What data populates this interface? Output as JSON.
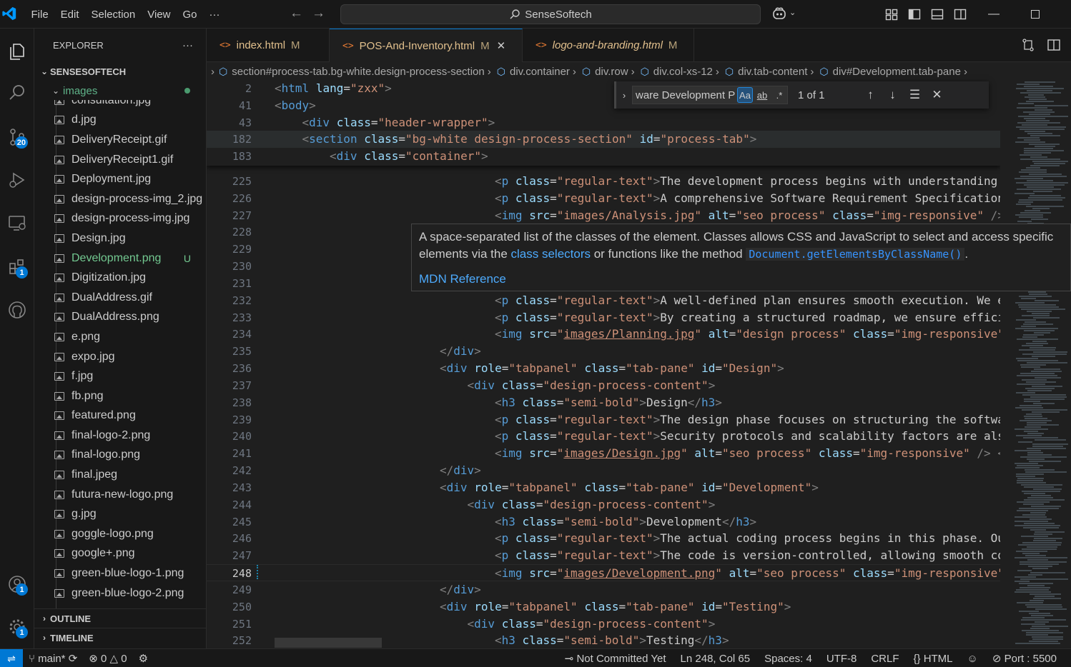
{
  "title_bar": {
    "menu": [
      "File",
      "Edit",
      "Selection",
      "View",
      "Go"
    ],
    "search_text": "SenseSoftech"
  },
  "activity_bar": {
    "source_control_badge": "20",
    "extensions_badge": "1",
    "accounts_badge": "1",
    "manage_badge": "1"
  },
  "sidebar": {
    "title": "EXPLORER",
    "more": "···",
    "root": "SENSESOFTECH",
    "folder": "images",
    "files": [
      {
        "name": "consultation.jpg",
        "status": ""
      },
      {
        "name": "d.jpg",
        "status": ""
      },
      {
        "name": "DeliveryReceipt.gif",
        "status": ""
      },
      {
        "name": "DeliveryReceipt1.gif",
        "status": ""
      },
      {
        "name": "Deployment.jpg",
        "status": ""
      },
      {
        "name": "design-process-img_2.jpg",
        "status": ""
      },
      {
        "name": "design-process-img.jpg",
        "status": ""
      },
      {
        "name": "Design.jpg",
        "status": ""
      },
      {
        "name": "Development.png",
        "status": "U"
      },
      {
        "name": "Digitization.jpg",
        "status": ""
      },
      {
        "name": "DualAddress.gif",
        "status": ""
      },
      {
        "name": "DualAddress.png",
        "status": ""
      },
      {
        "name": "e.png",
        "status": ""
      },
      {
        "name": "expo.jpg",
        "status": ""
      },
      {
        "name": "f.jpg",
        "status": ""
      },
      {
        "name": "fb.png",
        "status": ""
      },
      {
        "name": "featured.png",
        "status": ""
      },
      {
        "name": "final-logo-2.png",
        "status": ""
      },
      {
        "name": "final-logo.png",
        "status": ""
      },
      {
        "name": "final.jpeg",
        "status": ""
      },
      {
        "name": "futura-new-logo.png",
        "status": ""
      },
      {
        "name": "g.jpg",
        "status": ""
      },
      {
        "name": "goggle-logo.png",
        "status": ""
      },
      {
        "name": "google+.png",
        "status": ""
      },
      {
        "name": "green-blue-logo-1.png",
        "status": ""
      },
      {
        "name": "green-blue-logo-2.png",
        "status": ""
      }
    ],
    "outline": "OUTLINE",
    "timeline": "TIMELINE"
  },
  "tabs": [
    {
      "label": "index.html",
      "status": "M",
      "active": false
    },
    {
      "label": "POS-And-Inventory.html",
      "status": "M",
      "active": true
    },
    {
      "label": "logo-and-branding.html",
      "status": "M",
      "active": false
    }
  ],
  "breadcrumbs": [
    "section#process-tab.bg-white.design-process-section",
    "div.container",
    "div.row",
    "div.col-xs-12",
    "div.tab-content",
    "div#Development.tab-pane"
  ],
  "find": {
    "query": "ware Development Process",
    "match_case": "Aa",
    "whole_word": "ab",
    "regex": ".*",
    "count": "1 of 1"
  },
  "hover": {
    "text1": "A space-separated list of the classes of the element. Classes allows CSS and JavaScript to select and access specific",
    "text2a": "elements via the ",
    "link1": "class selectors",
    "text2b": " or functions like the method ",
    "code": "Document.getElementsByClassName()",
    "text2c": ".",
    "mdn": "MDN Reference"
  },
  "sticky_lines": [
    {
      "n": "2",
      "indent": 0,
      "tag": "html",
      "attrs": [
        [
          "lang",
          "zxx"
        ]
      ],
      "text": ""
    },
    {
      "n": "41",
      "indent": 0,
      "tag": "body",
      "attrs": [],
      "text": ""
    },
    {
      "n": "43",
      "indent": 1,
      "tag": "div",
      "attrs": [
        [
          "class",
          "header-wrapper"
        ]
      ],
      "text": ""
    },
    {
      "n": "182",
      "indent": 1,
      "tag": "section",
      "attrs": [
        [
          "class",
          "bg-white design-process-section"
        ],
        [
          "id",
          "process-tab"
        ]
      ],
      "text": ""
    },
    {
      "n": "183",
      "indent": 2,
      "tag": "div",
      "attrs": [
        [
          "class",
          "container"
        ]
      ],
      "text": ""
    }
  ],
  "code_lines": [
    {
      "n": "225",
      "indent": 8,
      "html": "<span class='t'>&lt;</span><span class='tn'>p</span> <span class='an'>class</span><span class='tx'>=</span><span class='av'>\"regular-text\"</span><span class='t'>&gt;</span><span class='tx'>The development process begins with understanding</span>"
    },
    {
      "n": "226",
      "indent": 8,
      "html": "<span class='t'>&lt;</span><span class='tn'>p</span> <span class='an'>class</span><span class='tx'>=</span><span class='av'>\"regular-text\"</span><span class='t'>&gt;</span><span class='tx'>A comprehensive Software Requirement Specification</span>"
    },
    {
      "n": "227",
      "indent": 8,
      "html": "<span class='t'>&lt;</span><span class='tn'>img</span> <span class='an'>src</span><span class='tx'>=</span><span class='av'>\"images/Analysis.jpg\"</span> <span class='an'>alt</span><span class='tx'>=</span><span class='av'>\"seo process\"</span> <span class='an'>class</span><span class='tx'>=</span><span class='av'>\"img-responsive\"</span> <span class='t'>/&gt;</span>"
    },
    {
      "n": "228",
      "indent": 0,
      "html": ""
    },
    {
      "n": "229",
      "indent": 0,
      "html": ""
    },
    {
      "n": "230",
      "indent": 0,
      "html": ""
    },
    {
      "n": "231",
      "indent": 0,
      "html": ""
    },
    {
      "n": "232",
      "indent": 8,
      "html": "<span class='t'>&lt;</span><span class='tn'>p</span> <span class='an'>class</span><span class='tx'>=</span><span class='av'>\"regular-text\"</span><span class='t'>&gt;</span><span class='tx'>A well-defined plan ensures smooth execution. We e</span>"
    },
    {
      "n": "233",
      "indent": 8,
      "html": "<span class='t'>&lt;</span><span class='tn'>p</span> <span class='an'>class</span><span class='tx'>=</span><span class='av'>\"regular-text\"</span><span class='t'>&gt;</span><span class='tx'>By creating a structured roadmap, we ensure effici</span>"
    },
    {
      "n": "234",
      "indent": 8,
      "html": "<span class='t'>&lt;</span><span class='tn'>img</span> <span class='an'>src</span><span class='tx'>=</span><span class='av'>\"<u>images/Planning.jpg</u>\"</span> <span class='an'>alt</span><span class='tx'>=</span><span class='av'>\"design process\"</span> <span class='an'>class</span><span class='tx'>=</span><span class='av'>\"img-responsive\"</span>"
    },
    {
      "n": "235",
      "indent": 6,
      "html": "<span class='t'>&lt;/</span><span class='tn'>div</span><span class='t'>&gt;</span>"
    },
    {
      "n": "236",
      "indent": 6,
      "html": "<span class='t'>&lt;</span><span class='tn'>div</span> <span class='an'>role</span><span class='tx'>=</span><span class='av'>\"tabpanel\"</span> <span class='an'>class</span><span class='tx'>=</span><span class='av'>\"tab-pane\"</span> <span class='an'>id</span><span class='tx'>=</span><span class='av'>\"Design\"</span><span class='t'>&gt;</span>"
    },
    {
      "n": "237",
      "indent": 7,
      "html": "<span class='t'>&lt;</span><span class='tn'>div</span> <span class='an'>class</span><span class='tx'>=</span><span class='av'>\"design-process-content\"</span><span class='t'>&gt;</span>"
    },
    {
      "n": "238",
      "indent": 8,
      "html": "<span class='t'>&lt;</span><span class='tn'>h3</span> <span class='an'>class</span><span class='tx'>=</span><span class='av'>\"semi-bold\"</span><span class='t'>&gt;</span><span class='tx'>Design</span><span class='t'>&lt;/</span><span class='tn'>h3</span><span class='t'>&gt;</span>"
    },
    {
      "n": "239",
      "indent": 8,
      "html": "<span class='t'>&lt;</span><span class='tn'>p</span> <span class='an'>class</span><span class='tx'>=</span><span class='av'>\"regular-text\"</span><span class='t'>&gt;</span><span class='tx'>The design phase focuses on structuring the softwa</span>"
    },
    {
      "n": "240",
      "indent": 8,
      "html": "<span class='t'>&lt;</span><span class='tn'>p</span> <span class='an'>class</span><span class='tx'>=</span><span class='av'>\"regular-text\"</span><span class='t'>&gt;</span><span class='tx'>Security protocols and scalability factors are als</span>"
    },
    {
      "n": "241",
      "indent": 8,
      "html": "<span class='t'>&lt;</span><span class='tn'>img</span> <span class='an'>src</span><span class='tx'>=</span><span class='av'>\"<u>images/Design.jpg</u>\"</span> <span class='an'>alt</span><span class='tx'>=</span><span class='av'>\"seo process\"</span> <span class='an'>class</span><span class='tx'>=</span><span class='av'>\"img-responsive\"</span> <span class='t'>/&gt; &lt;</span>"
    },
    {
      "n": "242",
      "indent": 6,
      "html": "<span class='t'>&lt;/</span><span class='tn'>div</span><span class='t'>&gt;</span>"
    },
    {
      "n": "243",
      "indent": 6,
      "html": "<span class='t'>&lt;</span><span class='tn'>div</span> <span class='an'>role</span><span class='tx'>=</span><span class='av'>\"tabpanel\"</span> <span class='an'>class</span><span class='tx'>=</span><span class='av'>\"tab-pane\"</span> <span class='an'>id</span><span class='tx'>=</span><span class='av'>\"Development\"</span><span class='t'>&gt;</span>"
    },
    {
      "n": "244",
      "indent": 7,
      "html": "<span class='t'>&lt;</span><span class='tn'>div</span> <span class='an'>class</span><span class='tx'>=</span><span class='av'>\"design-process-content\"</span><span class='t'>&gt;</span>"
    },
    {
      "n": "245",
      "indent": 8,
      "html": "<span class='t'>&lt;</span><span class='tn'>h3</span> <span class='an'>class</span><span class='tx'>=</span><span class='av'>\"semi-bold\"</span><span class='t'>&gt;</span><span class='tx'>Development</span><span class='t'>&lt;/</span><span class='tn'>h3</span><span class='t'>&gt;</span>"
    },
    {
      "n": "246",
      "indent": 8,
      "html": "<span class='t'>&lt;</span><span class='tn'>p</span> <span class='an'>class</span><span class='tx'>=</span><span class='av'>\"regular-text\"</span><span class='t'>&gt;</span><span class='tx'>The actual coding process begins in this phase. Ou</span>"
    },
    {
      "n": "247",
      "indent": 8,
      "html": "<span class='t'>&lt;</span><span class='tn'>p</span> <span class='an'>class</span><span class='tx'>=</span><span class='av'>\"regular-text\"</span><span class='t'>&gt;</span><span class='tx'>The code is version-controlled, allowing smooth co</span>"
    },
    {
      "n": "248",
      "indent": 8,
      "html": "<span class='t'>&lt;</span><span class='tn'>img</span> <span class='an'>src</span><span class='tx'>=</span><span class='av'>\"<u>images/Development.png</u>\"</span> <span class='an'>alt</span><span class='tx'>=</span><span class='av'>\"seo process\"</span> <span class='an'>class</span><span class='tx'>=</span><span class='av'>\"img-responsive\"</span>"
    },
    {
      "n": "249",
      "indent": 6,
      "html": "<span class='t'>&lt;/</span><span class='tn'>div</span><span class='t'>&gt;</span>"
    },
    {
      "n": "250",
      "indent": 6,
      "html": "<span class='t'>&lt;</span><span class='tn'>div</span> <span class='an'>role</span><span class='tx'>=</span><span class='av'>\"tabpanel\"</span> <span class='an'>class</span><span class='tx'>=</span><span class='av'>\"tab-pane\"</span> <span class='an'>id</span><span class='tx'>=</span><span class='av'>\"Testing\"</span><span class='t'>&gt;</span>"
    },
    {
      "n": "251",
      "indent": 7,
      "html": "<span class='t'>&lt;</span><span class='tn'>div</span> <span class='an'>class</span><span class='tx'>=</span><span class='av'>\"design-process-content\"</span><span class='t'>&gt;</span>"
    },
    {
      "n": "252",
      "indent": 8,
      "html": "<span class='t'>&lt;</span><span class='tn'>h3</span> <span class='an'>class</span><span class='tx'>=</span><span class='av'>\"semi-bold\"</span><span class='t'>&gt;</span><span class='tx'>Testing</span><span class='t'>&lt;/</span><span class='tn'>h3</span><span class='t'>&gt;</span>"
    }
  ],
  "current_line": "248",
  "status_bar": {
    "branch": "main*",
    "errors": "0",
    "warnings": "0",
    "blame": "Not Committed Yet",
    "position": "Ln 248, Col 65",
    "spaces": "Spaces: 4",
    "encoding": "UTF-8",
    "eol": "CRLF",
    "language": "HTML",
    "port": "Port : 5500"
  },
  "colors": {
    "accent": "#0078d4",
    "modified": "#e2c08d",
    "untracked": "#73c991"
  }
}
